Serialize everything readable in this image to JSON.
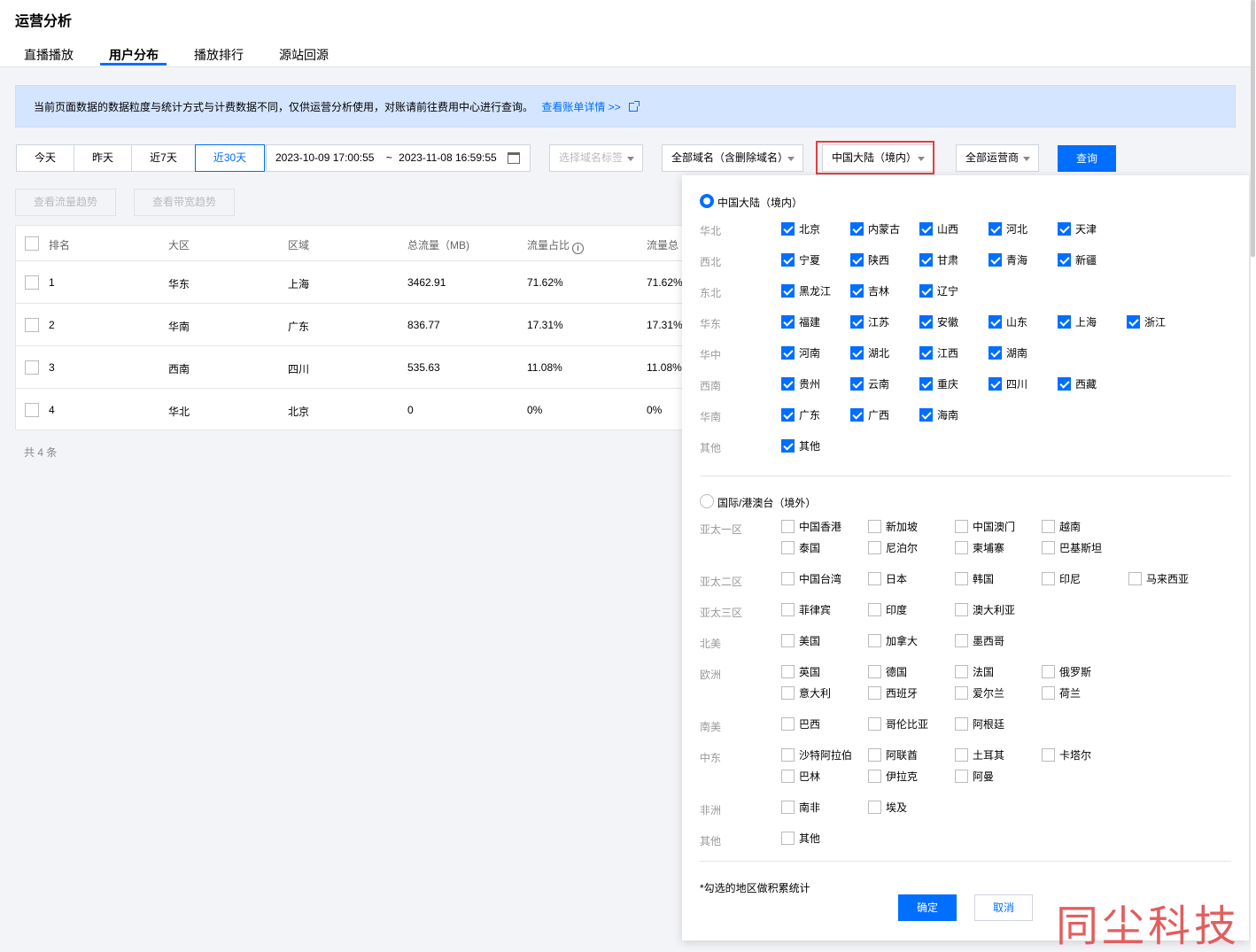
{
  "page": {
    "title": "运营分析"
  },
  "tabs": [
    {
      "label": "直播播放"
    },
    {
      "label": "用户分布"
    },
    {
      "label": "播放排行"
    },
    {
      "label": "源站回源"
    }
  ],
  "notice": {
    "text": "当前页面数据的数据粒度与统计方式与计费数据不同，仅供运营分析使用，对账请前往费用中心进行查询。",
    "link": "查看账单详情 >>"
  },
  "filters": {
    "ranges": [
      "今天",
      "昨天",
      "近7天",
      "近30天"
    ],
    "active_range": "近30天",
    "date_start": "2023-10-09 17:00:55",
    "date_sep": "~",
    "date_end": "2023-11-08 16:59:55",
    "domain_tag_placeholder": "选择域名标签",
    "domain": "全部域名（含删除域名）",
    "region": "中国大陆（境内）",
    "isp": "全部运营商",
    "query_label": "查询"
  },
  "trend_buttons": {
    "traffic": "查看流量趋势",
    "bandwidth": "查看带宽趋势"
  },
  "table": {
    "headers": [
      "排名",
      "大区",
      "区域",
      "总流量（MB)",
      "流量占比",
      "流量总占比"
    ],
    "header_visible": [
      "排名",
      "大区",
      "区域",
      "总流量（MB)",
      "流量占比",
      "流量总"
    ],
    "rows": [
      {
        "rank": "1",
        "zone": "华东",
        "area": "上海",
        "traffic": "3462.91",
        "ratio": "71.62%",
        "total_ratio": "71.62%"
      },
      {
        "rank": "2",
        "zone": "华南",
        "area": "广东",
        "traffic": "836.77",
        "ratio": "17.31%",
        "total_ratio": "17.31%"
      },
      {
        "rank": "3",
        "zone": "西南",
        "area": "四川",
        "traffic": "535.63",
        "ratio": "11.08%",
        "total_ratio": "11.08%"
      },
      {
        "rank": "4",
        "zone": "华北",
        "area": "北京",
        "traffic": "0",
        "ratio": "0%",
        "total_ratio": "0%"
      }
    ],
    "total": "共 4 条"
  },
  "region_panel": {
    "domestic_label": "中国大陆（境内）",
    "domestic_selected": true,
    "domestic_groups": [
      {
        "name": "华北",
        "items": [
          "北京",
          "内蒙古",
          "山西",
          "河北",
          "天津"
        ]
      },
      {
        "name": "西北",
        "items": [
          "宁夏",
          "陕西",
          "甘肃",
          "青海",
          "新疆"
        ]
      },
      {
        "name": "东北",
        "items": [
          "黑龙江",
          "吉林",
          "辽宁"
        ]
      },
      {
        "name": "华东",
        "items": [
          "福建",
          "江苏",
          "安徽",
          "山东",
          "上海",
          "浙江"
        ]
      },
      {
        "name": "华中",
        "items": [
          "河南",
          "湖北",
          "江西",
          "湖南"
        ]
      },
      {
        "name": "西南",
        "items": [
          "贵州",
          "云南",
          "重庆",
          "四川",
          "西藏"
        ]
      },
      {
        "name": "华南",
        "items": [
          "广东",
          "广西",
          "海南"
        ]
      },
      {
        "name": "其他",
        "items": [
          "其他"
        ]
      }
    ],
    "overseas_label": "国际/港澳台（境外）",
    "overseas_selected": false,
    "overseas_groups": [
      {
        "name": "亚太一区",
        "items": [
          "中国香港",
          "新加坡",
          "中国澳门",
          "越南",
          "泰国",
          "尼泊尔",
          "柬埔寨",
          "巴基斯坦"
        ]
      },
      {
        "name": "亚太二区",
        "items": [
          "中国台湾",
          "日本",
          "韩国",
          "印尼",
          "马来西亚"
        ]
      },
      {
        "name": "亚太三区",
        "items": [
          "菲律宾",
          "印度",
          "澳大利亚"
        ]
      },
      {
        "name": "北美",
        "items": [
          "美国",
          "加拿大",
          "墨西哥"
        ]
      },
      {
        "name": "欧洲",
        "items": [
          "英国",
          "德国",
          "法国",
          "俄罗斯",
          "意大利",
          "西班牙",
          "爱尔兰",
          "荷兰"
        ]
      },
      {
        "name": "南美",
        "items": [
          "巴西",
          "哥伦比亚",
          "阿根廷"
        ]
      },
      {
        "name": "中东",
        "items": [
          "沙特阿拉伯",
          "阿联酋",
          "土耳其",
          "卡塔尔",
          "巴林",
          "伊拉克",
          "阿曼"
        ]
      },
      {
        "name": "非洲",
        "items": [
          "南非",
          "埃及"
        ]
      },
      {
        "name": "其他",
        "items": [
          "其他"
        ]
      }
    ],
    "note": "*勾选的地区做积累统计",
    "ok_label": "确定",
    "cancel_label": "取消"
  },
  "watermark": "同尘科技",
  "colors": {
    "accent": "#006eff",
    "highlight_border": "#e0403f",
    "watermark": "#e25e5e",
    "notice_bg": "#d4e5ff"
  }
}
